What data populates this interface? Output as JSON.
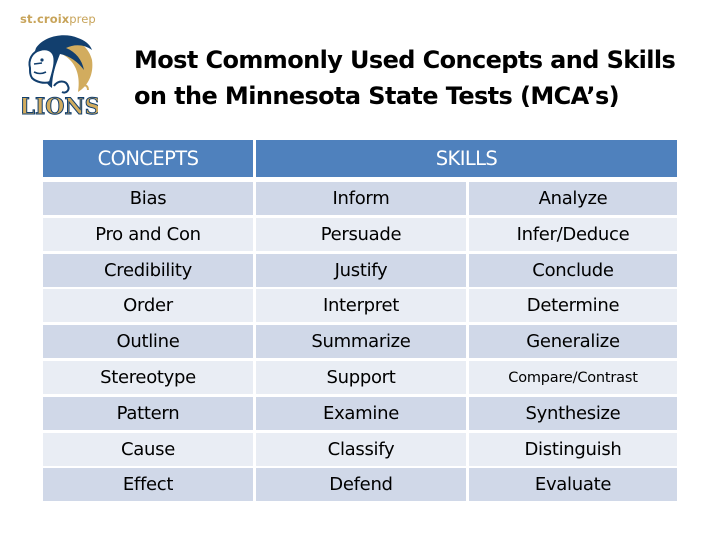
{
  "header": {
    "brand_bold": "st.croix",
    "brand_light": "prep",
    "logo_text": "LIONS",
    "title_line1": "Most Commonly Used Concepts and Skills",
    "title_line2": "on the Minnesota State Tests (MCA’s)"
  },
  "colors": {
    "header_blue": "#4f81bd",
    "row_dark": "#d0d8e8",
    "row_light": "#e9edf4",
    "brand_gold": "#c8a45a",
    "brand_navy": "#123f6e"
  },
  "table": {
    "headers": {
      "concepts": "CONCEPTS",
      "skills": "SKILLS"
    },
    "rows": [
      {
        "concept": "Bias",
        "skill1": "Inform",
        "skill2": "Analyze"
      },
      {
        "concept": "Pro and Con",
        "skill1": "Persuade",
        "skill2": "Infer/Deduce"
      },
      {
        "concept": "Credibility",
        "skill1": "Justify",
        "skill2": "Conclude"
      },
      {
        "concept": "Order",
        "skill1": "Interpret",
        "skill2": "Determine"
      },
      {
        "concept": "Outline",
        "skill1": "Summarize",
        "skill2": "Generalize"
      },
      {
        "concept": "Stereotype",
        "skill1": "Support",
        "skill2": "Compare/Contrast"
      },
      {
        "concept": "Pattern",
        "skill1": "Examine",
        "skill2": "Synthesize"
      },
      {
        "concept": "Cause",
        "skill1": "Classify",
        "skill2": "Distinguish"
      },
      {
        "concept": "Effect",
        "skill1": "Defend",
        "skill2": "Evaluate"
      }
    ]
  }
}
